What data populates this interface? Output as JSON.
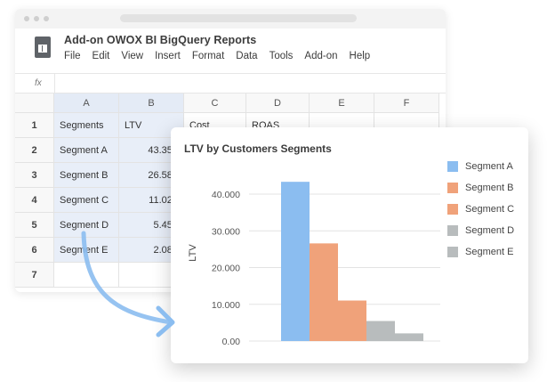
{
  "app": {
    "title": "Add-on OWOX BI BigQuery Reports",
    "menu": [
      "File",
      "Edit",
      "View",
      "Insert",
      "Format",
      "Data",
      "Tools",
      "Add-on",
      "Help"
    ],
    "formula_label": "fx"
  },
  "sheet": {
    "columns": [
      "A",
      "B",
      "C",
      "D",
      "E",
      "F"
    ],
    "rows": [
      "1",
      "2",
      "3",
      "4",
      "5",
      "6",
      "7"
    ],
    "cells": [
      [
        "Segments",
        "LTV",
        "Cost",
        "ROAS",
        "",
        ""
      ],
      [
        "Segment A",
        "43.351",
        "",
        "",
        "",
        ""
      ],
      [
        "Segment B",
        "26.584",
        "",
        "",
        "",
        ""
      ],
      [
        "Segment C",
        "11.027",
        "",
        "",
        "",
        ""
      ],
      [
        "Segment D",
        "5.455",
        "",
        "",
        "",
        ""
      ],
      [
        "Segment E",
        "2.086",
        "",
        "",
        "",
        ""
      ],
      [
        "",
        "",
        "",
        "",
        "",
        ""
      ]
    ]
  },
  "chart_data": {
    "type": "bar",
    "title": "LTV by Customers Segments",
    "ylabel": "LTV",
    "xlabel": "",
    "ylim": [
      0,
      48000
    ],
    "yticks": [
      "0.00",
      "10.000",
      "20.000",
      "30.000",
      "40.000"
    ],
    "ytick_values": [
      0,
      10000,
      20000,
      30000,
      40000
    ],
    "grid": true,
    "legend_position": "right",
    "series": [
      {
        "name": "Segment A",
        "value": 43351,
        "color": "#8bbdf0"
      },
      {
        "name": "Segment B",
        "value": 26584,
        "color": "#f0a27a"
      },
      {
        "name": "Segment C",
        "value": 11027,
        "color": "#f0a27a"
      },
      {
        "name": "Segment D",
        "value": 5455,
        "color": "#b8bcbd"
      },
      {
        "name": "Segment E",
        "value": 2086,
        "color": "#b8bcbd"
      }
    ]
  },
  "colors": {
    "selection": "#e8eef8",
    "arrow": "#8bbdf0"
  }
}
